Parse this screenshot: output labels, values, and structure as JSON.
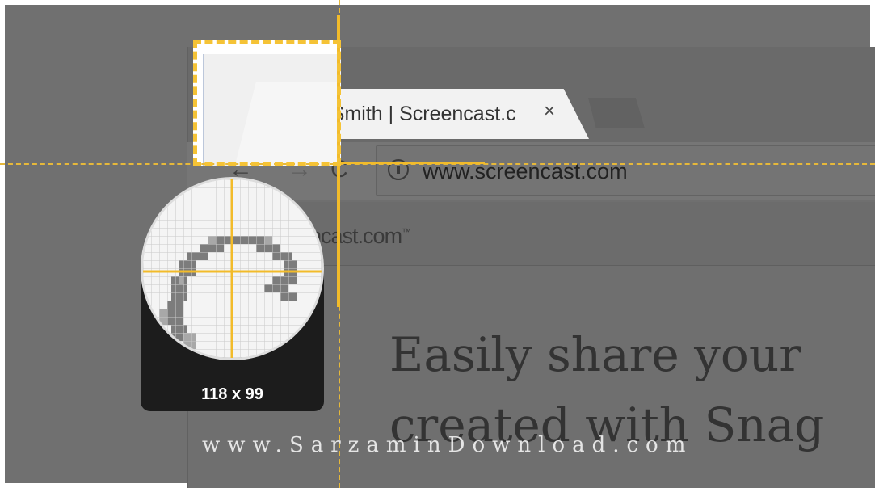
{
  "browser": {
    "tab": {
      "title": "TechSmith | Screencast.c",
      "close_glyph": "×",
      "favicon": "screencast-play-icon"
    },
    "toolbar": {
      "back_glyph": "←",
      "forward_glyph": "→",
      "reload_glyph": "C",
      "url": "www.screencast.com"
    },
    "site_logo": "encast.com",
    "site_logo_mark": "™",
    "hero_line_1": "Easily share your",
    "hero_line_2": "created with Snag"
  },
  "capture": {
    "dimensions": "118 x 99",
    "accent_color": "#f5c336"
  },
  "watermark": "www.SarzaminDownload.com"
}
